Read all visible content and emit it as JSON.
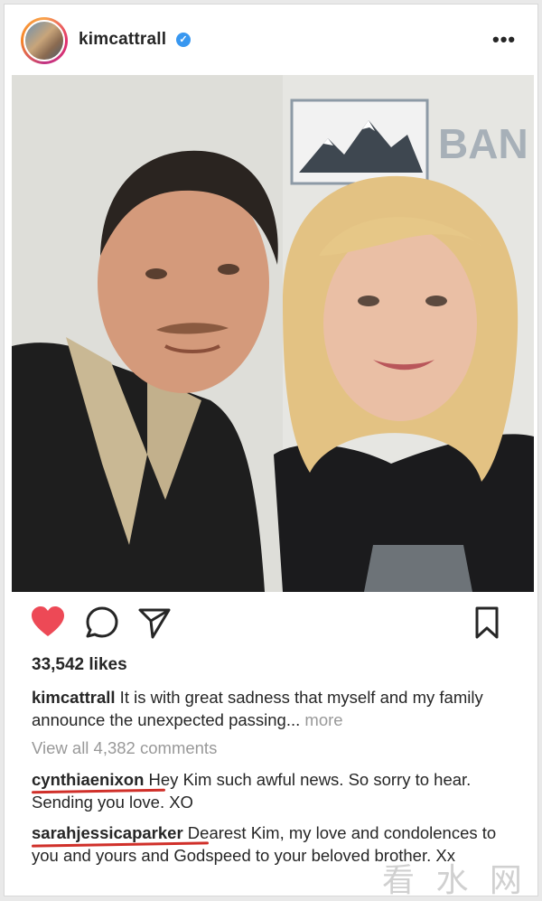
{
  "post": {
    "username": "kimcattrall",
    "verified_glyph": "✓",
    "more_glyph": "•••",
    "photo": {
      "sign_text": "BAN"
    },
    "actions": {
      "like_icon": "heart-filled-icon",
      "comment_icon": "comment-icon",
      "share_icon": "send-icon",
      "save_icon": "bookmark-icon",
      "like_color": "#ed4956"
    },
    "likes": "33,542 likes",
    "caption": {
      "username": "kimcattrall",
      "text": " It is with great sadness that myself and my family announce the unexpected passing... ",
      "more": "more"
    },
    "view_all": "View all 4,382 comments",
    "comments": [
      {
        "username": "cynthiaenixon",
        "text": " Hey Kim such awful news. So sorry to hear. Sending you love. XO"
      },
      {
        "username": "sarahjessicaparker",
        "text": " Dearest Kim, my love and condolences to you and yours and Godspeed to your beloved brother. Xx"
      }
    ]
  },
  "watermark": "看 水 网",
  "colors": {
    "underline": "#d0302a",
    "muted": "#999999"
  }
}
